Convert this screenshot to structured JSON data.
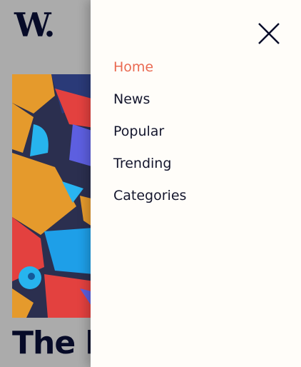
{
  "brand": {
    "logo_text": "W."
  },
  "article": {
    "headline": "The l"
  },
  "menu": {
    "items": [
      {
        "label": "Home",
        "active": true
      },
      {
        "label": "News",
        "active": false
      },
      {
        "label": "Popular",
        "active": false
      },
      {
        "label": "Trending",
        "active": false
      },
      {
        "label": "Categories",
        "active": false
      }
    ]
  },
  "colors": {
    "accent": "#ea6a52",
    "text": "#15172e",
    "drawer_bg": "#fffdf9",
    "overlay_bg": "#ababab"
  },
  "icons": {
    "close": "close-icon"
  }
}
